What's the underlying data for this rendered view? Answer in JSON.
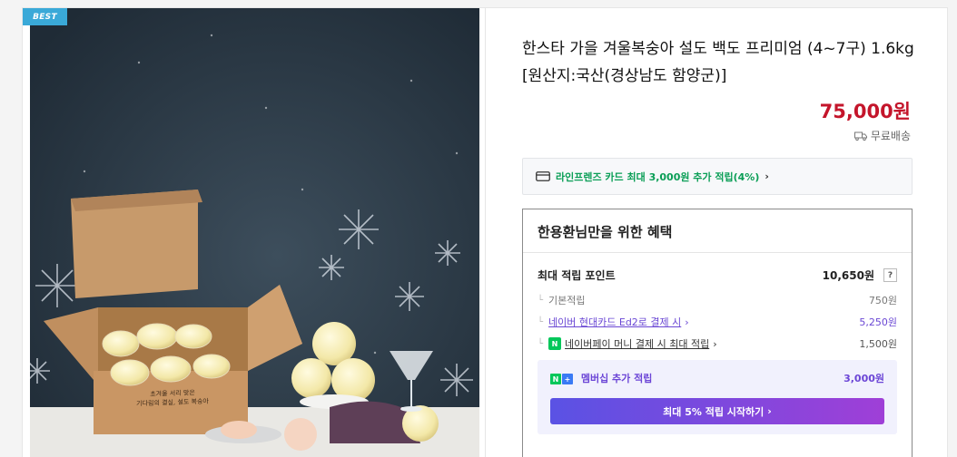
{
  "badge": "BEST",
  "product": {
    "title": "한스타 가을 겨울복숭아 설도 백도 프리미엄 (4~7구) 1.6kg [원산지:국산(경상남도 함양군)]",
    "price": "75,000원",
    "shipping": "무료배송",
    "box_text_line1": "초겨울 서리 맞은",
    "box_text_line2": "기다림의 결실, 설도 복숭아"
  },
  "card_promo": {
    "text": "라인프렌즈 카드 최대 3,000원 추가 적립(4%)",
    "icon": "credit-card-icon"
  },
  "benefits": {
    "title": "한용환님만을 위한 혜택",
    "max_points_label": "최대 적립 포인트",
    "max_points_value": "10,650원",
    "help": "?",
    "basic_label": "기본적립",
    "basic_value": "750원",
    "hyundai_label": "네이버 현대카드 Ed2로 결제 시",
    "hyundai_value": "5,250원",
    "npay_label": "네이버페이 머니 결제 시 최대 적립",
    "npay_value": "1,500원",
    "npay_badge": "N",
    "membership_label": "멤버십 추가 적립",
    "membership_value": "3,000원",
    "membership_badge_n": "N",
    "membership_badge_plus": "+",
    "cta": "최대 5% 적립 시작하기"
  },
  "colors": {
    "price": "#c4152b",
    "accent_green": "#0a9e56",
    "purple": "#6b45d6",
    "badge_blue": "#3aa9d8",
    "photo_bg": "#2b3a48"
  }
}
